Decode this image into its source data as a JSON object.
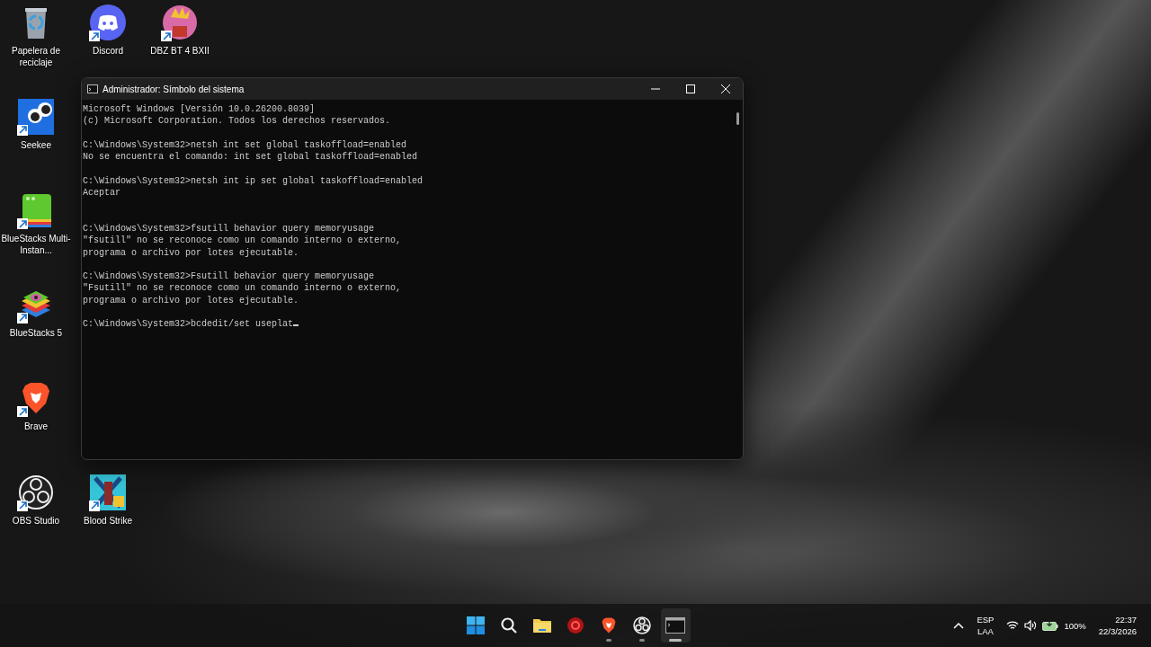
{
  "desktop": {
    "rows": [
      [
        {
          "label": "Papelera de reciclaje",
          "kind": "recycle",
          "shortcut": false
        },
        {
          "label": "Discord",
          "kind": "discord",
          "shortcut": true
        },
        {
          "label": "DBZ BT 4 BXII",
          "kind": "game",
          "shortcut": true
        }
      ],
      [
        {
          "label": "Seekee",
          "kind": "seekee",
          "shortcut": true
        }
      ],
      [
        {
          "label": "BlueStacks Multi-Instan...",
          "kind": "bluestacks-multi",
          "shortcut": true
        }
      ],
      [
        {
          "label": "BlueStacks 5",
          "kind": "bluestacks",
          "shortcut": true
        }
      ],
      [
        {
          "label": "Brave",
          "kind": "brave",
          "shortcut": true
        }
      ],
      [
        {
          "label": "OBS Studio",
          "kind": "obs",
          "shortcut": true
        },
        {
          "label": "Blood Strike",
          "kind": "game2",
          "shortcut": true
        }
      ]
    ]
  },
  "window": {
    "title": "Administrador: Símbolo del sistema",
    "lines": [
      {
        "kind": "text",
        "text": "Microsoft Windows [Versión 10.0.26200.8039]"
      },
      {
        "kind": "text",
        "text": "(c) Microsoft Corporation. Todos los derechos reservados."
      },
      {
        "kind": "blank"
      },
      {
        "kind": "text",
        "text": "C:\\Windows\\System32>netsh int set global taskoffload=enabled"
      },
      {
        "kind": "text",
        "text": "No se encuentra el comando: int set global taskoffload=enabled"
      },
      {
        "kind": "blank"
      },
      {
        "kind": "text",
        "text": "C:\\Windows\\System32>netsh int ip set global taskoffload=enabled"
      },
      {
        "kind": "text",
        "text": "Aceptar"
      },
      {
        "kind": "blank"
      },
      {
        "kind": "blank"
      },
      {
        "kind": "text",
        "text": "C:\\Windows\\System32>fsutill behavior query memoryusage"
      },
      {
        "kind": "text",
        "text": "\"fsutill\" no se reconoce como un comando interno o externo,"
      },
      {
        "kind": "text",
        "text": "programa o archivo por lotes ejecutable."
      },
      {
        "kind": "blank"
      },
      {
        "kind": "text",
        "text": "C:\\Windows\\System32>Fsutill behavior query memoryusage"
      },
      {
        "kind": "text",
        "text": "\"Fsutill\" no se reconoce como un comando interno o externo,"
      },
      {
        "kind": "text",
        "text": "programa o archivo por lotes ejecutable."
      },
      {
        "kind": "blank"
      },
      {
        "kind": "input",
        "text": "C:\\Windows\\System32>bcdedit/set useplat",
        "cursor": true
      }
    ]
  },
  "taskbar": {
    "apps": [
      {
        "kind": "start",
        "running": false,
        "active": false
      },
      {
        "kind": "search",
        "running": false,
        "active": false
      },
      {
        "kind": "folder",
        "running": false,
        "active": false
      },
      {
        "kind": "red-app",
        "running": false,
        "active": false
      },
      {
        "kind": "brave",
        "running": true,
        "active": false
      },
      {
        "kind": "obs",
        "running": true,
        "active": false
      },
      {
        "kind": "terminal",
        "running": true,
        "active": true
      }
    ],
    "tray": {
      "language": "ESP",
      "layout": "LAA",
      "battery": "100%",
      "time": "22:37",
      "date": "22/3/2026"
    }
  }
}
